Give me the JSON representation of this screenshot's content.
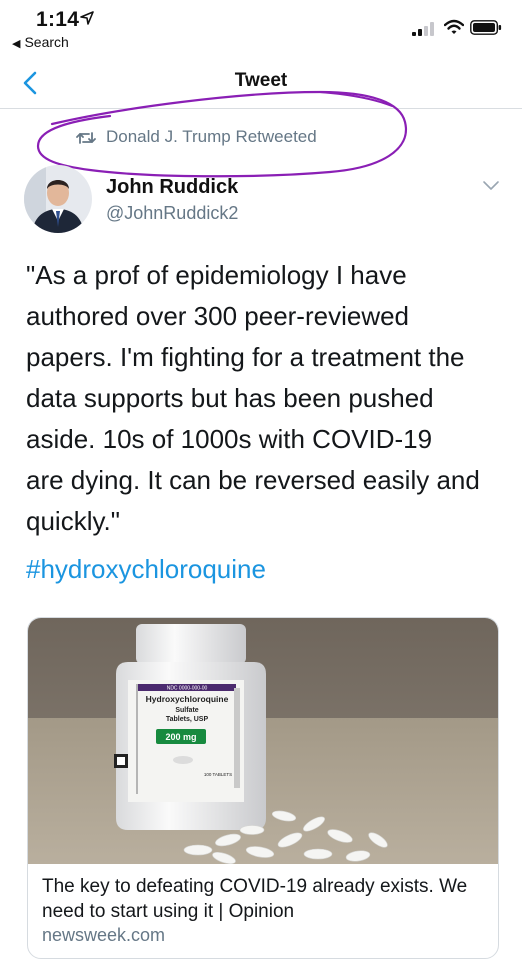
{
  "status_bar": {
    "time": "1:14",
    "back_label": "Search",
    "icons": [
      "location-arrow-icon",
      "signal-bars-icon",
      "wifi-icon",
      "battery-icon"
    ]
  },
  "nav": {
    "title": "Tweet",
    "back_icon": "chevron-left-icon"
  },
  "retweet": {
    "icon": "retweet-icon",
    "label": "Donald J. Trump Retweeted"
  },
  "author": {
    "name": "John Ruddick",
    "handle": "@JohnRuddick2"
  },
  "tweet": {
    "text": "\"As a prof of epidemiology I have\nauthored over 300 peer-reviewed\npapers. I'm fighting for a treatment the\ndata supports but has been pushed\naside. 10s of 1000s with COVID-19\nare dying. It can be reversed easily and\nquickly.\"",
    "hashtag": "#hydroxychloroquine"
  },
  "card": {
    "title": "The key to defeating COVID-19 already exists. We need to start using it | Opinion",
    "domain": "newsweek.com",
    "image": {
      "bottle_label_title": "Hydroxychloroquine",
      "bottle_label_sub1": "Sulfate",
      "bottle_label_sub2": "Tablets, USP",
      "dose": "200 mg",
      "count": "100 TABLETS"
    }
  },
  "colors": {
    "accent": "#1b95e0",
    "secondary_text": "#657786",
    "annotation": "#8a1fb5",
    "card_border": "#d6dbe0"
  }
}
